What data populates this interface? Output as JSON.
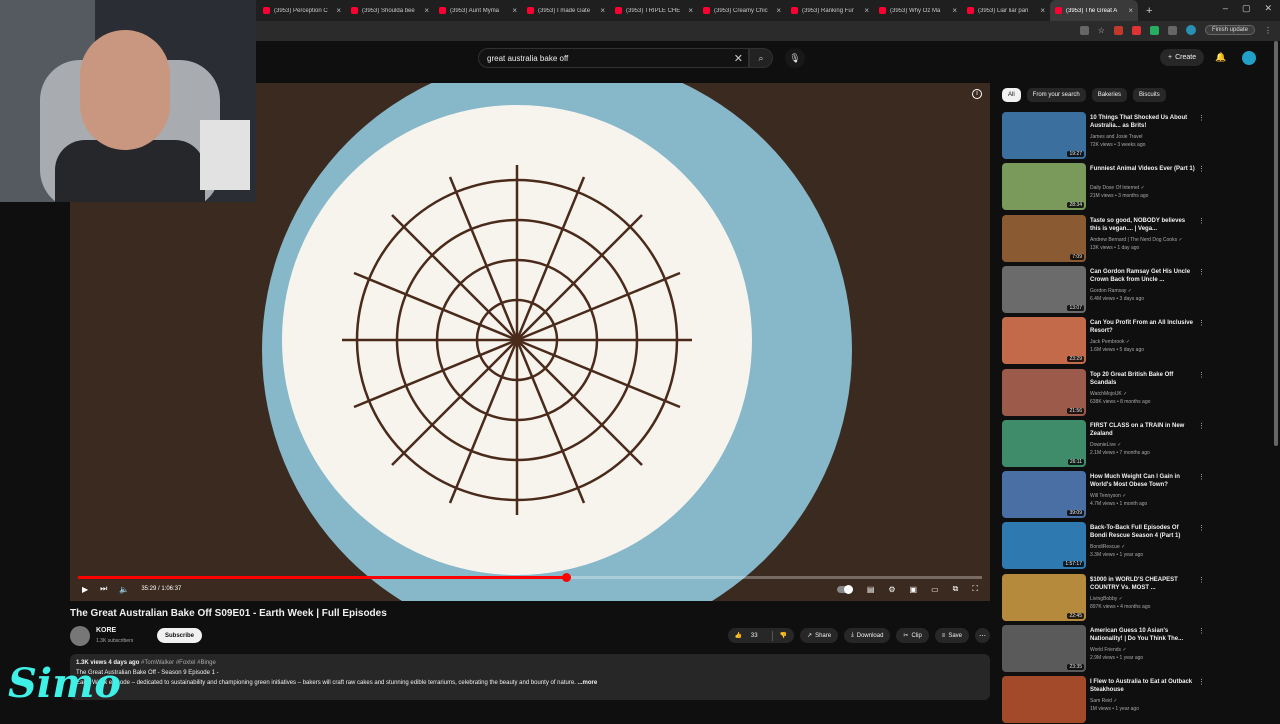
{
  "browser": {
    "tabs": [
      {
        "label": "(3953) Perception C"
      },
      {
        "label": "(3953) Shoulda bee"
      },
      {
        "label": "(3953) Aunt Myma"
      },
      {
        "label": "(3953) I made Gate"
      },
      {
        "label": "(3953) TRIPLE CHE"
      },
      {
        "label": "(3953) Creamy Chic"
      },
      {
        "label": "(3953) Ranking Fur"
      },
      {
        "label": "(3953) Why Oz Ma"
      },
      {
        "label": "(3953) Liar liar pan"
      },
      {
        "label": "(3953) The Great A"
      }
    ],
    "finish_update": "Finish update"
  },
  "search": {
    "query": "great australia bake off"
  },
  "header": {
    "create": "Create"
  },
  "player": {
    "time": "35:29 / 1:06:37",
    "progress_fraction": 0.54
  },
  "video": {
    "title": "The Great Australian Bake Off S09E01 - Earth Week | Full Episodes",
    "channel": "KORE",
    "subscribers": "1.3K subscribers",
    "subscribe": "Subscribe",
    "likes": "33",
    "share": "Share",
    "download": "Download",
    "clip": "Clip",
    "save": "Save"
  },
  "description": {
    "meta": "1.3K views  4 days ago",
    "tags": "#TomWalker #Foxtel #Binge",
    "line1": "The Great Australian Bake Off - Season 9 Episode 1 -",
    "line2": "Earth Week episode – dedicated to sustainability and championing green initiatives – bakers will craft raw cakes and stunning edible terrariums, celebrating the beauty and bounty of nature.",
    "more": "...more"
  },
  "overlay_logo": "Simo",
  "chips": [
    "All",
    "From your search",
    "Bakeries",
    "Biscuits"
  ],
  "recommendations": [
    {
      "title": "10 Things That Shocked Us About Australia... as Brits!",
      "channel": "James and Josie Travel",
      "meta": "72K views • 3 weeks ago",
      "duration": "19:27",
      "color": "#3b6f9e"
    },
    {
      "title": "Funniest Animal Videos Ever (Part 1)",
      "channel": "Daily Dose Of Internet ✓",
      "meta": "21M views • 3 months ago",
      "duration": "28:34",
      "color": "#7a9a5c"
    },
    {
      "title": "Taste so good, NOBODY believes this is vegan.... | Vega...",
      "channel": "Andrew Bernard | The Nerd Dog Cooks ✓",
      "meta": "13K views • 1 day ago",
      "duration": "7:09",
      "color": "#8a5a32"
    },
    {
      "title": "Can Gordon Ramsay Get His Uncle Crown Back from Uncle ...",
      "channel": "Gordon Ramsay ✓",
      "meta": "6.4M views • 3 days ago",
      "duration": "13:07",
      "color": "#6b6b6b"
    },
    {
      "title": "Can You Profit From an All Inclusive Resort?",
      "channel": "Jack Pembrook ✓",
      "meta": "1.6M views • 5 days ago",
      "duration": "23:29",
      "color": "#c26a4a"
    },
    {
      "title": "Top 20 Great British Bake Off Scandals",
      "channel": "WatchMojoUK ✓",
      "meta": "638K views • 8 months ago",
      "duration": "21:56",
      "color": "#9b5a4a"
    },
    {
      "title": "FIRST CLASS on a TRAIN in New Zealand",
      "channel": "DownieLive ✓",
      "meta": "2.1M views • 7 months ago",
      "duration": "26:11",
      "color": "#3e8c6a"
    },
    {
      "title": "How Much Weight Can I Gain in World's Most Obese Town?",
      "channel": "Will Tennyson ✓",
      "meta": "4.7M views • 1 month ago",
      "duration": "39:09",
      "color": "#4a6fa5"
    },
    {
      "title": "Back-To-Back Full Episodes Of Bondi Rescue Season 4 (Part 1)",
      "channel": "BondiRescue ✓",
      "meta": "3.3M views • 1 year ago",
      "duration": "1:57:17",
      "color": "#2e7ab0"
    },
    {
      "title": "$1000 in WORLD'S CHEAPEST COUNTRY Vs. MOST ...",
      "channel": "LivingBobby ✓",
      "meta": "897K views • 4 months ago",
      "duration": "22:45",
      "color": "#b58a3c"
    },
    {
      "title": "American Guess 10 Asian's Nationality! | Do You Think The...",
      "channel": "World Friends ✓",
      "meta": "2.9M views • 1 year ago",
      "duration": "23:35",
      "color": "#5a5a5a"
    },
    {
      "title": "I Flew to Australia to Eat at Outback Steakhouse",
      "channel": "Sam Reid ✓",
      "meta": "1M views • 1 year ago",
      "duration": "",
      "color": "#a34a2a"
    }
  ]
}
